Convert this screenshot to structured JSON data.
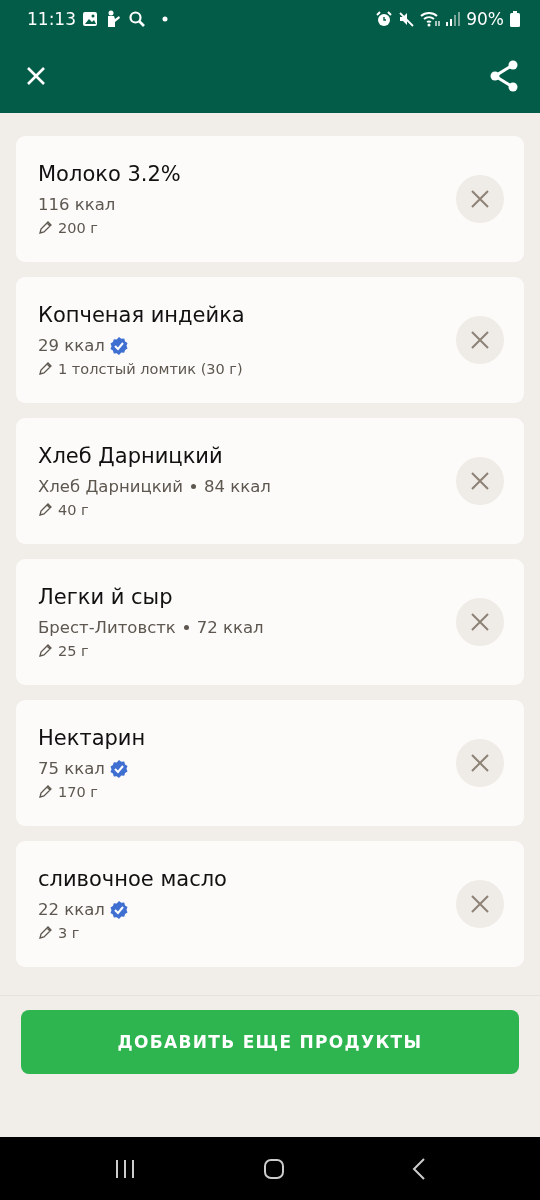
{
  "status_bar": {
    "time": "11:13",
    "battery": "90%"
  },
  "items": [
    {
      "name": "Молоко 3.2%",
      "kcal": "116 ккал",
      "verified": false,
      "portion": "200 г"
    },
    {
      "name": "Копченая индейка",
      "kcal": "29 ккал",
      "verified": true,
      "portion": "1 толстый ломтик (30 г)"
    },
    {
      "name": "Хлеб Дарницкий",
      "brand": "Хлеб Дарницкий",
      "kcal": "84 ккал",
      "verified": false,
      "portion": "40 г"
    },
    {
      "name": "Легки й сыр",
      "brand": "Брест-Литовстк",
      "kcal": "72 ккал",
      "verified": false,
      "portion": "25 г"
    },
    {
      "name": "Нектарин",
      "kcal": "75 ккал",
      "verified": true,
      "portion": "170 г"
    },
    {
      "name": "сливочное масло",
      "kcal": "22 ккал",
      "verified": true,
      "portion": "3 г"
    }
  ],
  "add_button": "ДОБАВИТЬ ЕЩЕ ПРОДУКТЫ"
}
